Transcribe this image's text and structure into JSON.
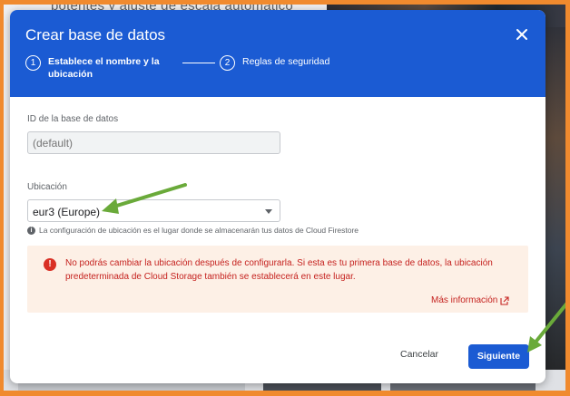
{
  "background": {
    "top_text": "potentes y ajuste de escala automático"
  },
  "dialog": {
    "title": "Crear base de datos",
    "close_icon": "close-icon",
    "steps": [
      {
        "number": "1",
        "label": "Establece el nombre y la ubicación",
        "active": true
      },
      {
        "number": "2",
        "label": "Reglas de seguridad",
        "active": false
      }
    ],
    "database_id": {
      "label": "ID de la base de datos",
      "placeholder": "(default)"
    },
    "location": {
      "label": "Ubicación",
      "value": "eur3 (Europe)",
      "hint": "La configuración de ubicación es el lugar donde se almacenarán tus datos de Cloud Firestore"
    },
    "warning": {
      "icon": "error-icon",
      "text": "No podrás cambiar la ubicación después de configurarla. Si esta es tu primera base de datos, la ubicación predeterminada de Cloud Storage también se establecerá en este lugar.",
      "link": "Más información"
    },
    "buttons": {
      "cancel": "Cancelar",
      "next": "Siguiente"
    }
  },
  "colors": {
    "header": "#1b5bd3",
    "primary_button": "#1b5bd3",
    "warning_bg": "#fdf0e6",
    "warning_text": "#c5221f",
    "annotation_arrow": "#6aaa3a",
    "frame": "#f08a2e"
  }
}
